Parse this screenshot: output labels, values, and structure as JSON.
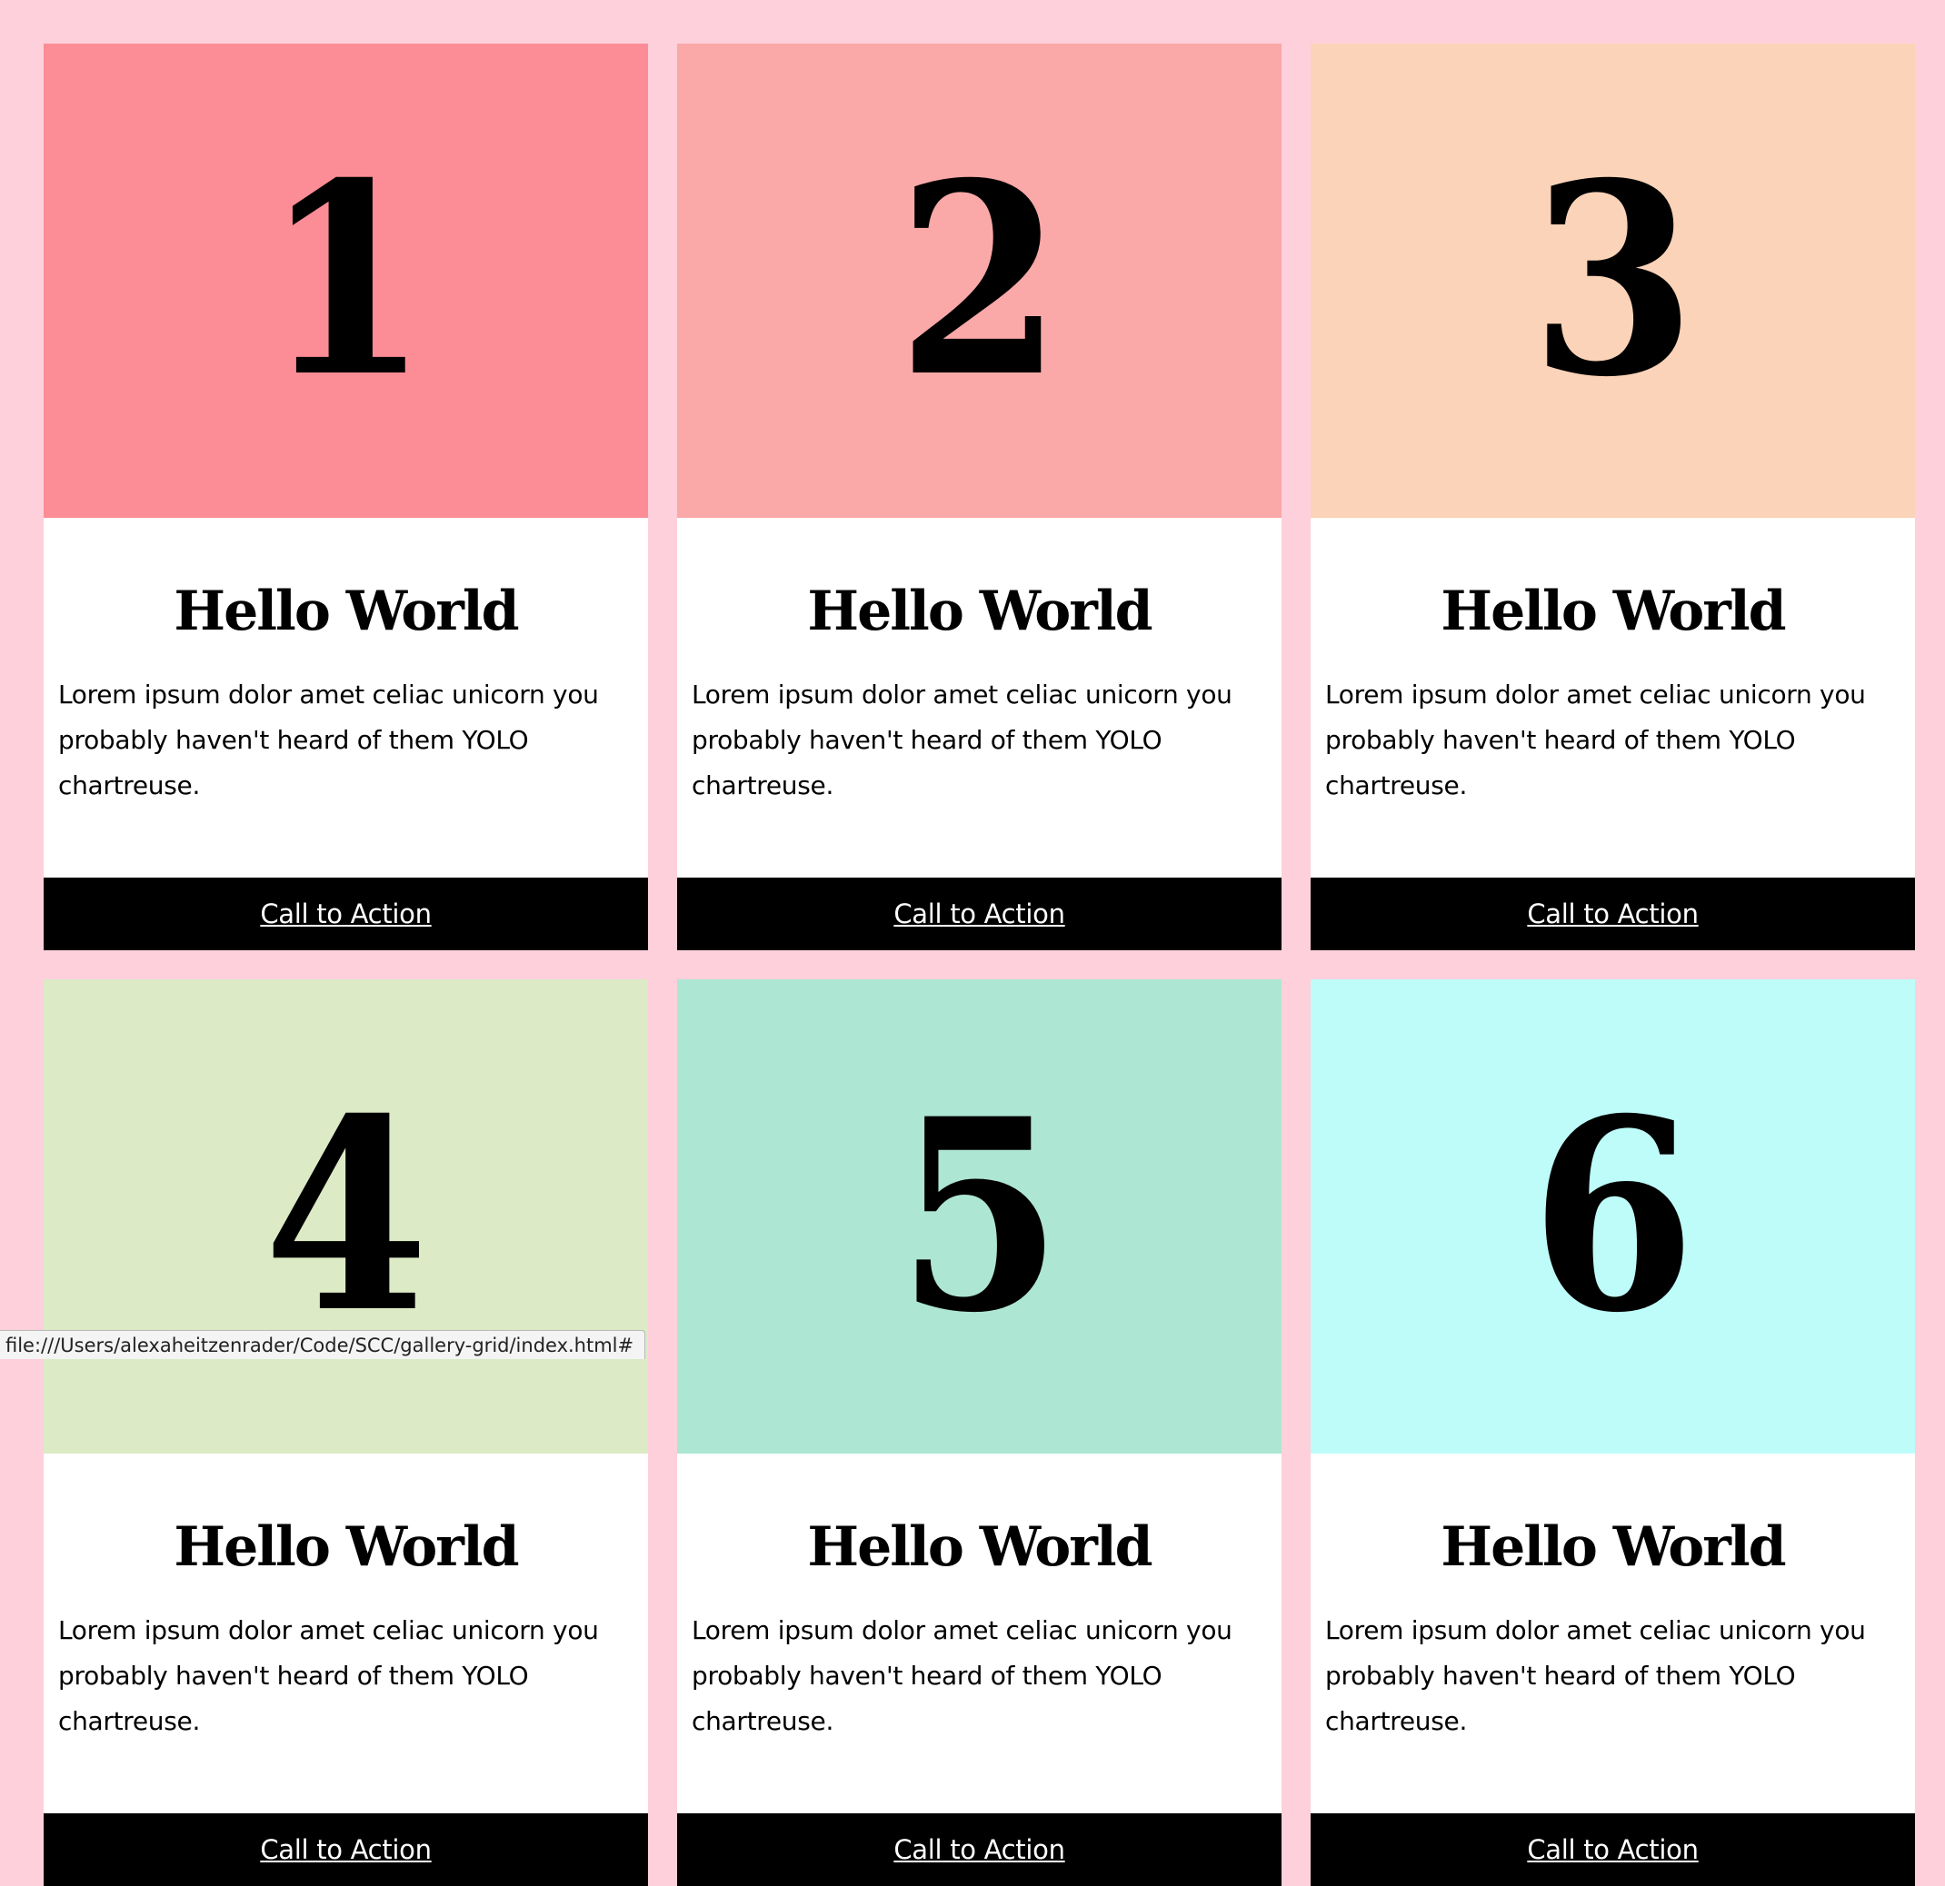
{
  "cards": [
    {
      "number": "1",
      "title": "Hello World",
      "text": "Lorem ipsum dolor amet celiac unicorn you probably haven't heard of them YOLO chartreuse.",
      "cta": "Call to Action",
      "color": "#fc8c96"
    },
    {
      "number": "2",
      "title": "Hello World",
      "text": "Lorem ipsum dolor amet celiac unicorn you probably haven't heard of them YOLO chartreuse.",
      "cta": "Call to Action",
      "color": "#faa8a8"
    },
    {
      "number": "3",
      "title": "Hello World",
      "text": "Lorem ipsum dolor amet celiac unicorn you probably haven't heard of them YOLO chartreuse.",
      "cta": "Call to Action",
      "color": "#fbd3b8"
    },
    {
      "number": "4",
      "title": "Hello World",
      "text": "Lorem ipsum dolor amet celiac unicorn you probably haven't heard of them YOLO chartreuse.",
      "cta": "Call to Action",
      "color": "#dceac6"
    },
    {
      "number": "5",
      "title": "Hello World",
      "text": "Lorem ipsum dolor amet celiac unicorn you probably haven't heard of them YOLO chartreuse.",
      "cta": "Call to Action",
      "color": "#ade6d2"
    },
    {
      "number": "6",
      "title": "Hello World",
      "text": "Lorem ipsum dolor amet celiac unicorn you probably haven't heard of them YOLO chartreuse.",
      "cta": "Call to Action",
      "color": "#befcfa"
    }
  ],
  "page_background": "#fdd0db",
  "status_bar": {
    "url": "file:///Users/alexaheitzenrader/Code/SCC/gallery-grid/index.html#"
  }
}
